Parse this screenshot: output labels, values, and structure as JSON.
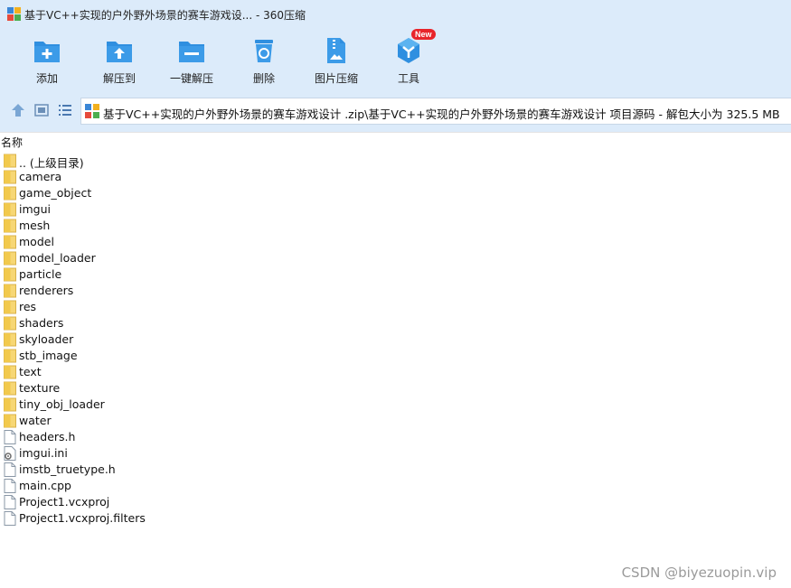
{
  "window": {
    "title": "基于VC++实现的户外野外场景的赛车游戏设... - 360压缩"
  },
  "toolbar": {
    "items": [
      {
        "label": "添加",
        "icon": "add-icon"
      },
      {
        "label": "解压到",
        "icon": "extract-to-icon"
      },
      {
        "label": "一键解压",
        "icon": "one-click-extract-icon"
      },
      {
        "label": "删除",
        "icon": "delete-icon"
      },
      {
        "label": "图片压缩",
        "icon": "image-compress-icon"
      },
      {
        "label": "工具",
        "icon": "tools-icon",
        "badge": "New"
      }
    ]
  },
  "nav": {
    "path": "基于VC++实现的户外野外场景的赛车游戏设计 .zip\\基于VC++实现的户外野外场景的赛车游戏设计 项目源码 - 解包大小为 325.5 MB"
  },
  "list": {
    "column_name": "名称",
    "items": [
      {
        "name": ".. (上级目录)",
        "type": "folder"
      },
      {
        "name": "camera",
        "type": "folder"
      },
      {
        "name": "game_object",
        "type": "folder"
      },
      {
        "name": "imgui",
        "type": "folder"
      },
      {
        "name": "mesh",
        "type": "folder"
      },
      {
        "name": "model",
        "type": "folder"
      },
      {
        "name": "model_loader",
        "type": "folder"
      },
      {
        "name": "particle",
        "type": "folder"
      },
      {
        "name": "renderers",
        "type": "folder"
      },
      {
        "name": "res",
        "type": "folder"
      },
      {
        "name": "shaders",
        "type": "folder"
      },
      {
        "name": "skyloader",
        "type": "folder"
      },
      {
        "name": "stb_image",
        "type": "folder"
      },
      {
        "name": "text",
        "type": "folder"
      },
      {
        "name": "texture",
        "type": "folder"
      },
      {
        "name": "tiny_obj_loader",
        "type": "folder"
      },
      {
        "name": "water",
        "type": "folder"
      },
      {
        "name": "headers.h",
        "type": "file"
      },
      {
        "name": "imgui.ini",
        "type": "settings-file"
      },
      {
        "name": "imstb_truetype.h",
        "type": "file"
      },
      {
        "name": "main.cpp",
        "type": "file"
      },
      {
        "name": "Project1.vcxproj",
        "type": "file"
      },
      {
        "name": "Project1.vcxproj.filters",
        "type": "file"
      }
    ]
  },
  "watermark": "CSDN @biyezuopin.vip",
  "colors": {
    "toolbar_bg": "#dcebfa",
    "icon_blue": "#2f8fe0",
    "folder_yellow": "#f7d774",
    "badge_red": "#e8242a"
  }
}
